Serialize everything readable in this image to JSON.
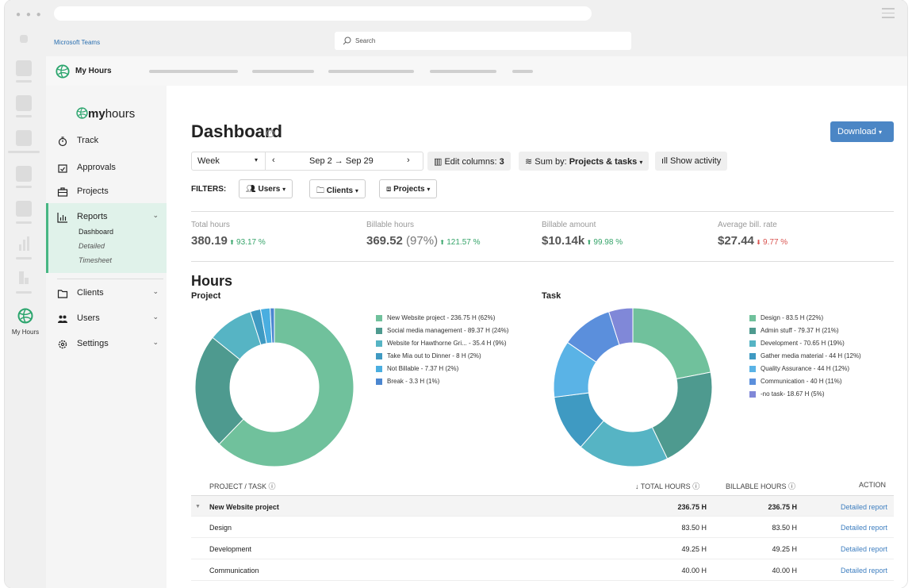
{
  "teams": {
    "title": "Microsoft Teams",
    "search_placeholder": "Search"
  },
  "rail": {
    "app_label": "My Hours"
  },
  "app": {
    "name": "My Hours"
  },
  "brand": {
    "prefix": "my",
    "suffix": "hours"
  },
  "nav": {
    "track": "Track",
    "approvals": "Approvals",
    "projects": "Projects",
    "reports": "Reports",
    "reports_sub": [
      "Dashboard",
      "Detailed",
      "Timesheet"
    ],
    "clients": "Clients",
    "users": "Users",
    "settings": "Settings"
  },
  "page": {
    "title": "Dashboard",
    "download": "Download"
  },
  "toolbar": {
    "period": "Week",
    "range": "Sep 2 → Sep 29",
    "edit_columns": "Edit columns: ",
    "edit_columns_count": "3",
    "sum_by": "Sum by: ",
    "sum_by_value": "Projects & tasks",
    "show_activity": "Show activity"
  },
  "filters": {
    "label": "FILTERS:",
    "users": "Users",
    "clients": "Clients",
    "projects": "Projects"
  },
  "stats": [
    {
      "label": "Total hours",
      "value": "380.19",
      "extra": "",
      "pct": "93.17 %",
      "direction": "up"
    },
    {
      "label": "Billable hours",
      "value": "369.52",
      "extra": " (97%)",
      "pct": "121.57 %",
      "direction": "up"
    },
    {
      "label": "Billable amount",
      "value": "$10.14k",
      "extra": "",
      "pct": "99.98 %",
      "direction": "up"
    },
    {
      "label": "Average bill. rate",
      "value": "$27.44",
      "extra": "",
      "pct": "9.77 %",
      "direction": "down"
    }
  ],
  "hours_title": "Hours",
  "charts": {
    "project_title": "Project",
    "task_title": "Task"
  },
  "chart_data": [
    {
      "type": "pie",
      "title": "Project",
      "categories": [
        "New Website project",
        "Social media management",
        "Website for Hawthorne Gri...",
        "Take Mia out to Dinner",
        "Not Billable",
        "Break"
      ],
      "values": [
        236.75,
        89.37,
        35.4,
        8,
        7.37,
        3.3
      ],
      "labels": [
        "New Website project - 236.75 H (62%)",
        "Social media management - 89.37 H (24%)",
        "Website for Hawthorne Gri... - 35.4 H (9%)",
        "Take Mia out to Dinner - 8 H (2%)",
        "Not Billable - 7.37 H (2%)",
        "Break - 3.3 H (1%)"
      ],
      "colors": [
        "#70c19c",
        "#4e9a8f",
        "#56b4c4",
        "#3f9ac2",
        "#4aaee0",
        "#4b86d0"
      ],
      "start_angle_deg": 90,
      "legend": "right"
    },
    {
      "type": "pie",
      "title": "Task",
      "categories": [
        "Design",
        "Admin stuff",
        "Development",
        "Gather media material",
        "Quality Assurance",
        "Communication",
        "-no task-"
      ],
      "values": [
        83.5,
        79.37,
        70.65,
        44,
        44,
        40,
        18.67
      ],
      "labels": [
        "Design - 83.5 H (22%)",
        "Admin stuff - 79.37 H (21%)",
        "Development - 70.65 H (19%)",
        "Gather media material - 44 H (12%)",
        "Quality Assurance - 44 H (12%)",
        "Communication - 40 H (11%)",
        "-no task- 18.67 H (5%)"
      ],
      "colors": [
        "#70c19c",
        "#4e9a8f",
        "#56b4c4",
        "#3f9ac2",
        "#5ab3e6",
        "#5b8fdc",
        "#8088d8"
      ],
      "start_angle_deg": 90,
      "legend": "right"
    }
  ],
  "table": {
    "headers": {
      "project": "PROJECT / TASK",
      "total": "TOTAL HOURS",
      "billable": "BILLABLE HOURS",
      "action": "ACTION"
    },
    "rows": [
      {
        "name": "New Website project",
        "total": "236.75 H",
        "billable": "236.75 H",
        "action": "Detailed report",
        "group": true
      },
      {
        "name": "Design",
        "total": "83.50 H",
        "billable": "83.50 H",
        "action": "Detailed report",
        "group": false
      },
      {
        "name": "Development",
        "total": "49.25 H",
        "billable": "49.25 H",
        "action": "Detailed report",
        "group": false
      },
      {
        "name": "Communication",
        "total": "40.00 H",
        "billable": "40.00 H",
        "action": "Detailed report",
        "group": false
      }
    ]
  }
}
